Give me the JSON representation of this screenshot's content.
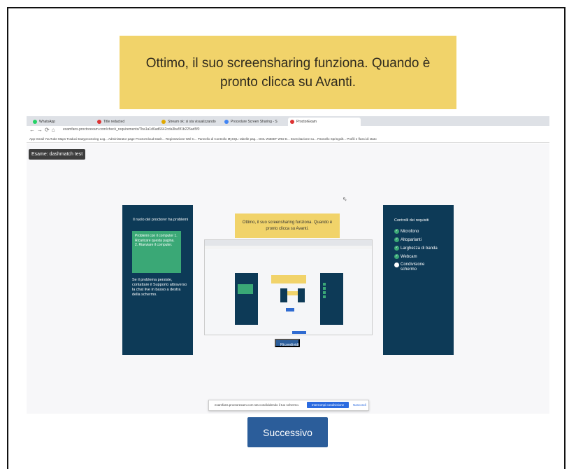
{
  "banner": {
    "text": "Ottimo, il suo screensharing funziona. Quando è pronto clicca su Avanti."
  },
  "browser": {
    "tabs": [
      "WhatsApp",
      "Title redacted",
      "Stream ok: si sta visualizzando",
      "Procedure Screen Sharing - S",
      "ProctorExam"
    ],
    "url": "examfans.proctorexam.com/check_requirements/7ba1a1d6ad6642cda3ba5f1b225ad5f0",
    "bookmarks": "App  Gmail  YouTube  Maps  Traduci  Easyproctoring Log...  Administrator page  ProctorCloud Dash...  Registrazione Wel C...  Pannello di Controllo  MySQL: tabelle pag...  DOL W3DEF W02 E...  Esercitazione su...  Pannello Springsilt...  Profili e flussi di stato"
  },
  "page": {
    "exam_tag": "Esame: dashmatch test",
    "left_panel": {
      "intro": "Il ruolo del proctorer ha problemi",
      "green_box": "Problemi con il computer 1. Ricaricare questa pagina. 2. Riavviare il computer.",
      "footer": "Se il problema persiste, contattare il Supporto attraverso la chat live in basso a destra della schermo."
    },
    "center_banner": "Ottimo, il suo screensharing funziona. Quando è pronto clicca su Avanti.",
    "ricondividi_label": "Ricondividi",
    "right_panel": {
      "title": "Controlli dei requisiti",
      "checks": [
        {
          "label": "Microfono",
          "ok": true
        },
        {
          "label": "Altoparlanti",
          "ok": true
        },
        {
          "label": "Larghezza di banda",
          "ok": true
        },
        {
          "label": "Webcam",
          "ok": true
        },
        {
          "label": "Condivisione schermo",
          "ok": false
        }
      ]
    },
    "share_bar": {
      "message": "examfans.proctorexam.com sta condividendo il tuo schermo.",
      "stop_label": "Interrompi condivisione",
      "hide_label": "Nascondi"
    }
  },
  "footer": {
    "next_label": "Successivo"
  },
  "colors": {
    "banner_yellow": "#f1d36a",
    "panel_navy": "#0d3a57",
    "green": "#3aa876",
    "button_blue": "#2b5d9a"
  }
}
